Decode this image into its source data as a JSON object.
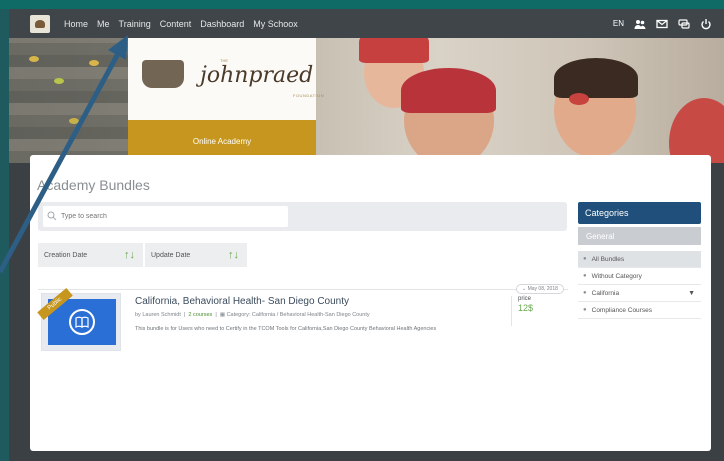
{
  "nav": {
    "links": [
      "Home",
      "Me",
      "Training",
      "Content",
      "Dashboard",
      "My Schoox"
    ],
    "lang": "EN",
    "icons": [
      "people-icon",
      "mail-icon",
      "chat-icon",
      "power-icon"
    ]
  },
  "hero": {
    "brand_script": "johnpraed",
    "brand_the": "THE",
    "brand_foundation": "FOUNDATION",
    "academy_label": "Online Academy"
  },
  "main": {
    "title": "Academy Bundles",
    "search_placeholder": "Type to search",
    "sort": [
      {
        "label": "Creation Date"
      },
      {
        "label": "Update Date"
      }
    ],
    "bundle": {
      "badge": "Public",
      "title": "California, Behavioral Health- San Diego County",
      "author_prefix": "by",
      "author": "Lauren Schmidt",
      "courses": "2 courses",
      "category": "Category: California / Behavioral Health-San Diego County",
      "description": "This bundle is for Users who need to Certify in the TCOM Tools for California,San Diego County Behavioral Health Agencies",
      "date": "May 08, 2018",
      "price_label": "price",
      "price": "12$"
    }
  },
  "categories": {
    "header": "Categories",
    "general": "General",
    "items": [
      "All Bundles",
      "Without Category",
      "California",
      "Compliance Courses"
    ]
  },
  "colors": {
    "frame": "#0f6b66",
    "nav_bg": "#3f4549",
    "gold": "#c6961e",
    "category_header": "#1f4f7a",
    "green": "#6aa84f",
    "annotation_arrow": "#2d5f86"
  }
}
